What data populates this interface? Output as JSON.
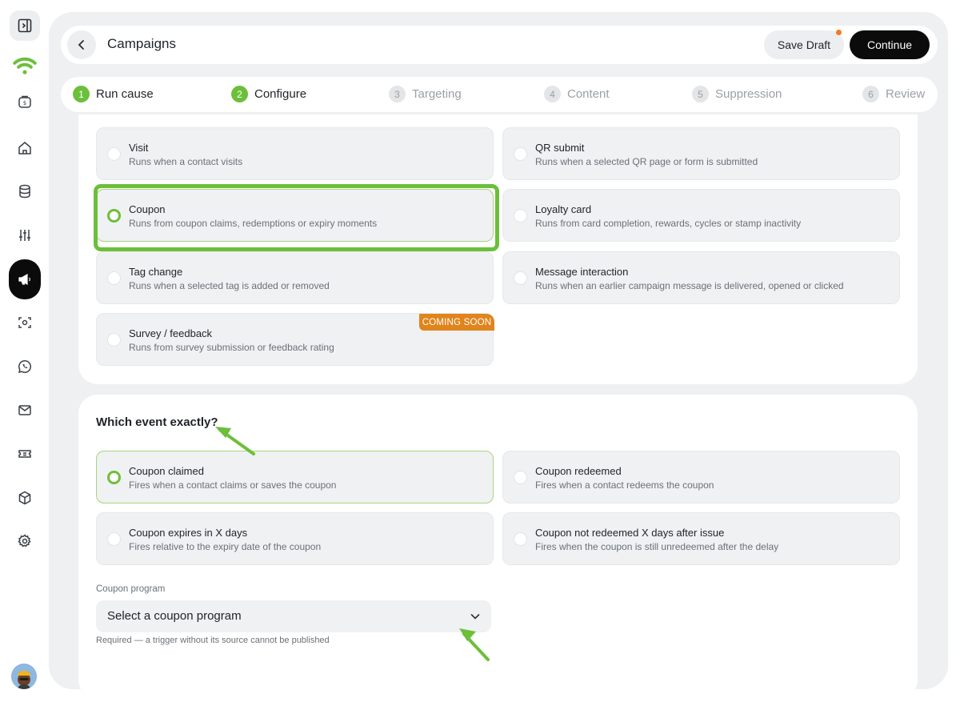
{
  "header": {
    "title": "Campaigns",
    "save_draft_label": "Save Draft",
    "continue_label": "Continue"
  },
  "steps": [
    {
      "number": "1",
      "label": "Run cause",
      "state": "done"
    },
    {
      "number": "2",
      "label": "Configure",
      "state": "done"
    },
    {
      "number": "3",
      "label": "Targeting",
      "state": "todo"
    },
    {
      "number": "4",
      "label": "Content",
      "state": "todo"
    },
    {
      "number": "5",
      "label": "Suppression",
      "state": "todo"
    },
    {
      "number": "6",
      "label": "Review",
      "state": "todo"
    }
  ],
  "triggers": [
    {
      "title": "Visit",
      "desc": "Runs when a contact visits",
      "selected": false
    },
    {
      "title": "QR submit",
      "desc": "Runs when a selected QR page or form is submitted",
      "selected": false
    },
    {
      "title": "Coupon",
      "desc": "Runs from coupon claims, redemptions or expiry moments",
      "selected": true
    },
    {
      "title": "Loyalty card",
      "desc": "Runs from card completion, rewards, cycles or stamp inactivity",
      "selected": false
    },
    {
      "title": "Tag change",
      "desc": "Runs when a selected tag is added or removed",
      "selected": false
    },
    {
      "title": "Message interaction",
      "desc": "Runs when an earlier campaign message is delivered, opened or clicked",
      "selected": false
    },
    {
      "title": "Survey / feedback",
      "desc": "Runs from survey submission or feedback rating",
      "selected": false,
      "badge": "COMING SOON"
    }
  ],
  "event_section": {
    "heading": "Which event exactly?",
    "events": [
      {
        "title": "Coupon claimed",
        "desc": "Fires when a contact claims or saves the coupon",
        "selected": true
      },
      {
        "title": "Coupon redeemed",
        "desc": "Fires when a contact redeems the coupon",
        "selected": false
      },
      {
        "title": "Coupon expires in X days",
        "desc": "Fires relative to the expiry date of the coupon",
        "selected": false
      },
      {
        "title": "Coupon not redeemed X days after issue",
        "desc": "Fires when the coupon is still unredeemed after the delay",
        "selected": false
      }
    ],
    "program_label": "Coupon program",
    "program_placeholder": "Select a coupon program",
    "program_helper": "Required — a trigger without its source cannot be published"
  },
  "icons": {
    "sidebar_toggle": "sidebar-toggle-icon",
    "brand": "wifi-logo-icon",
    "nav": [
      "wallet-icon",
      "home-icon",
      "database-icon",
      "sliders-icon",
      "megaphone-icon",
      "scan-icon",
      "whatsapp-icon",
      "mail-icon",
      "ticket-icon",
      "cube-icon",
      "gear-icon"
    ]
  },
  "colors": {
    "accent_green": "#6cbf3a",
    "badge_orange": "#e0851c",
    "draft_dot": "#f47a1f",
    "primary_button": "#0b0b0b",
    "panel_bg": "#eef0f1"
  }
}
